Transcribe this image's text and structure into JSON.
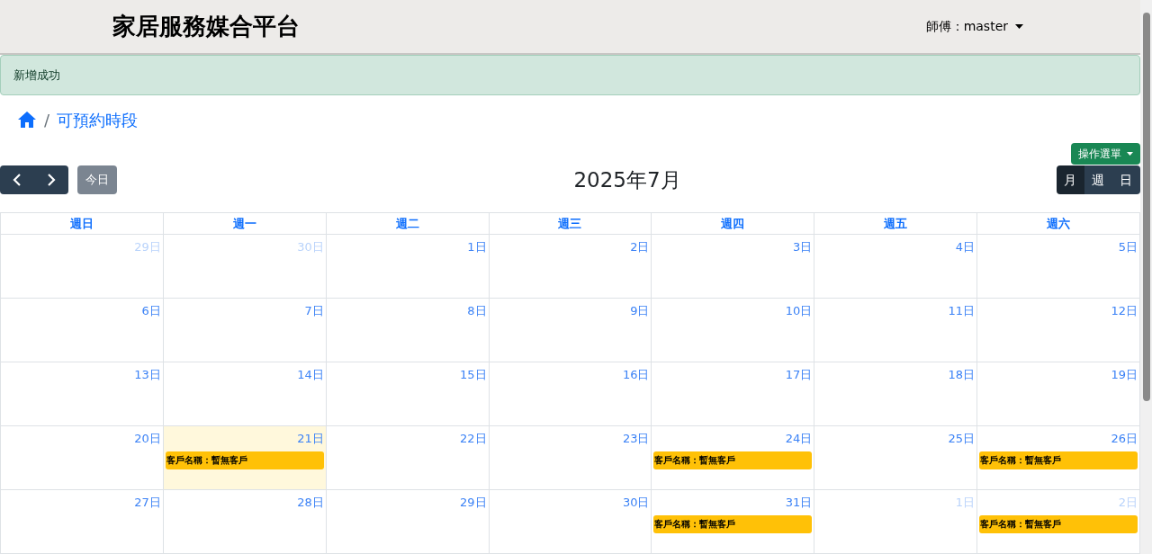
{
  "header": {
    "title": "家居服務媒合平台",
    "user_menu": "師傅：master"
  },
  "alert": {
    "text": "新增成功"
  },
  "breadcrumb": {
    "separator": "/",
    "current": "可預約時段"
  },
  "toolbar": {
    "today_button": "今日",
    "title": "2025年7月",
    "action_menu": "操作選單",
    "views": [
      {
        "label": "月",
        "selected": true
      },
      {
        "label": "週",
        "selected": false
      },
      {
        "label": "日",
        "selected": false
      }
    ]
  },
  "calendar": {
    "weekdays": [
      "週日",
      "週一",
      "週二",
      "週三",
      "週四",
      "週五",
      "週六"
    ],
    "weeks": [
      [
        {
          "day": "29日",
          "other_month": true,
          "today": false
        },
        {
          "day": "30日",
          "other_month": true,
          "today": false
        },
        {
          "day": "1日",
          "other_month": false,
          "today": false
        },
        {
          "day": "2日",
          "other_month": false,
          "today": false
        },
        {
          "day": "3日",
          "other_month": false,
          "today": false
        },
        {
          "day": "4日",
          "other_month": false,
          "today": false
        },
        {
          "day": "5日",
          "other_month": false,
          "today": false
        }
      ],
      [
        {
          "day": "6日",
          "other_month": false,
          "today": false
        },
        {
          "day": "7日",
          "other_month": false,
          "today": false
        },
        {
          "day": "8日",
          "other_month": false,
          "today": false
        },
        {
          "day": "9日",
          "other_month": false,
          "today": false
        },
        {
          "day": "10日",
          "other_month": false,
          "today": false
        },
        {
          "day": "11日",
          "other_month": false,
          "today": false
        },
        {
          "day": "12日",
          "other_month": false,
          "today": false
        }
      ],
      [
        {
          "day": "13日",
          "other_month": false,
          "today": false
        },
        {
          "day": "14日",
          "other_month": false,
          "today": false
        },
        {
          "day": "15日",
          "other_month": false,
          "today": false
        },
        {
          "day": "16日",
          "other_month": false,
          "today": false
        },
        {
          "day": "17日",
          "other_month": false,
          "today": false
        },
        {
          "day": "18日",
          "other_month": false,
          "today": false
        },
        {
          "day": "19日",
          "other_month": false,
          "today": false
        }
      ],
      [
        {
          "day": "20日",
          "other_month": false,
          "today": false
        },
        {
          "day": "21日",
          "other_month": false,
          "today": true,
          "events": [
            "客戶名稱：暫無客戶"
          ]
        },
        {
          "day": "22日",
          "other_month": false,
          "today": false
        },
        {
          "day": "23日",
          "other_month": false,
          "today": false
        },
        {
          "day": "24日",
          "other_month": false,
          "today": false,
          "events": [
            "客戶名稱：暫無客戶"
          ]
        },
        {
          "day": "25日",
          "other_month": false,
          "today": false
        },
        {
          "day": "26日",
          "other_month": false,
          "today": false,
          "events": [
            "客戶名稱：暫無客戶"
          ]
        }
      ],
      [
        {
          "day": "27日",
          "other_month": false,
          "today": false
        },
        {
          "day": "28日",
          "other_month": false,
          "today": false
        },
        {
          "day": "29日",
          "other_month": false,
          "today": false
        },
        {
          "day": "30日",
          "other_month": false,
          "today": false
        },
        {
          "day": "31日",
          "other_month": false,
          "today": false,
          "events": [
            "客戶名稱：暫無客戶"
          ]
        },
        {
          "day": "1日",
          "other_month": true,
          "today": false
        },
        {
          "day": "2日",
          "other_month": true,
          "today": false,
          "events": [
            "客戶名稱：暫無客戶"
          ]
        }
      ]
    ]
  }
}
